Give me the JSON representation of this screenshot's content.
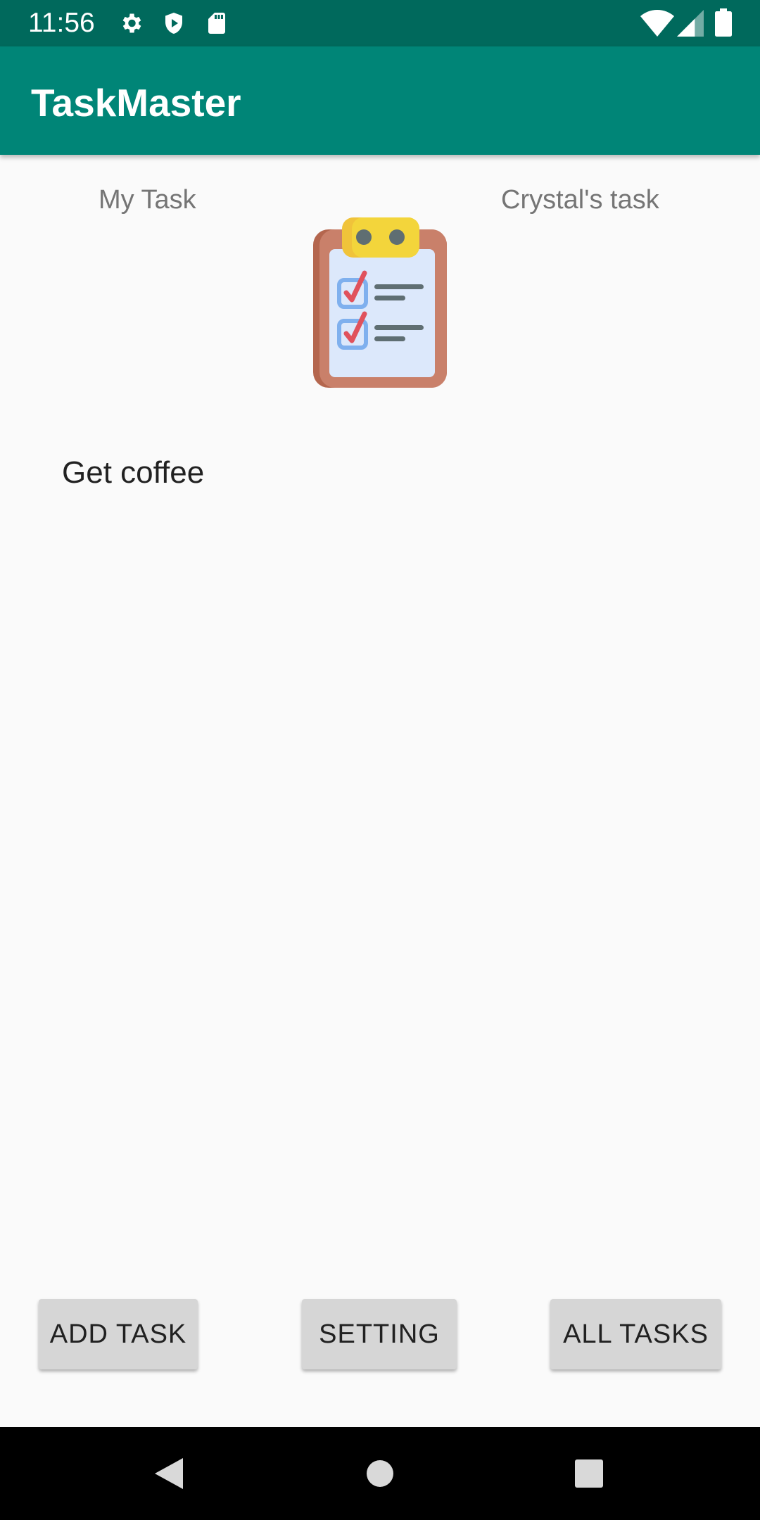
{
  "status_bar": {
    "time": "11:56",
    "left_icons": [
      "gear-icon",
      "shield-icon",
      "sd-card-icon"
    ],
    "right_icons": [
      "wifi-icon",
      "signal-icon",
      "battery-icon"
    ]
  },
  "app_bar": {
    "title": "TaskMaster",
    "color": "#008577"
  },
  "header_links": {
    "my_task": "My Task",
    "crystals_task": "Crystal's task"
  },
  "logo_icon": "clipboard-checklist-icon",
  "tasks": [
    "Get coffee"
  ],
  "buttons": {
    "add_task": "ADD TASK",
    "setting": "SETTING",
    "all_tasks": "ALL TASKS"
  },
  "nav_bar": {
    "icons": [
      "back-icon",
      "home-icon",
      "recents-icon"
    ]
  }
}
